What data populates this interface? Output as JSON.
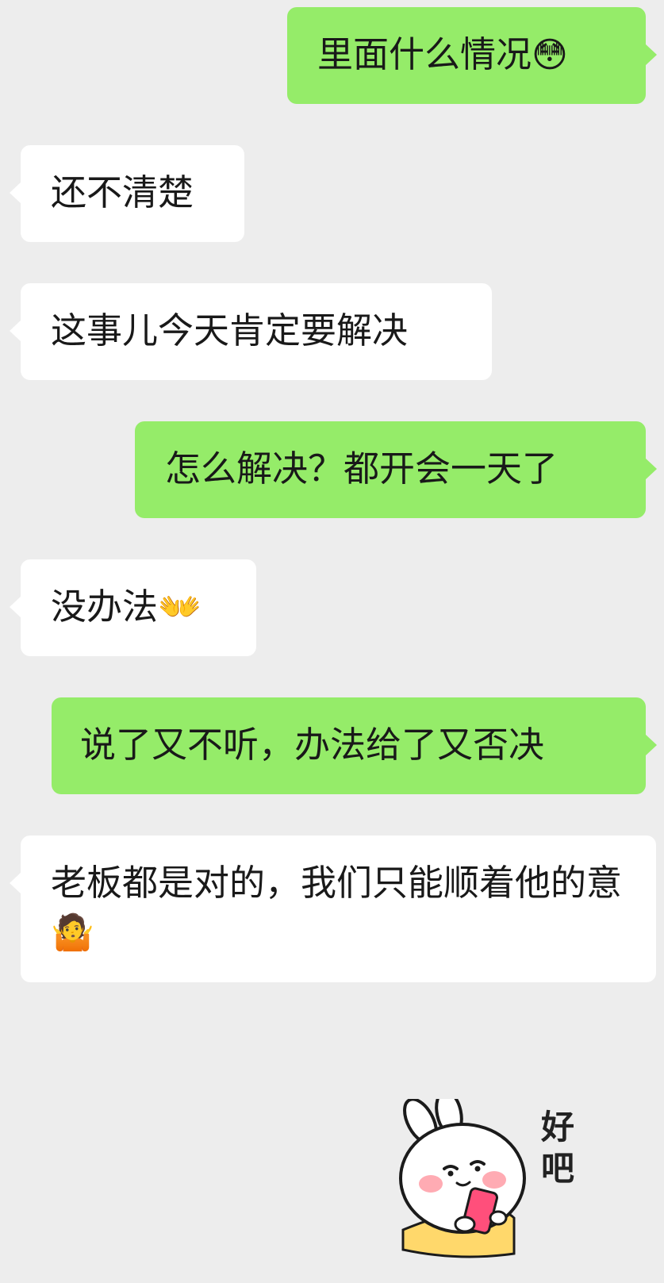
{
  "messages": [
    {
      "side": "out",
      "text": "里面什么情况",
      "emoji": "😳"
    },
    {
      "side": "in",
      "text": "还不清楚"
    },
    {
      "side": "in",
      "text": "这事儿今天肯定要解决"
    },
    {
      "side": "out",
      "text": "怎么解决？都开会一天了"
    },
    {
      "side": "in",
      "text": "没办法",
      "emoji": "👐"
    },
    {
      "side": "out",
      "text": "说了又不听，办法给了又否决"
    },
    {
      "side": "in",
      "text": "老板都是对的，我们只能顺着他的意",
      "emoji": "🤷"
    }
  ],
  "sticker": {
    "icon": "rabbit-holding-phone-sticker",
    "text": "好吧"
  },
  "colors": {
    "background": "#ededed",
    "incoming_bubble": "#ffffff",
    "outgoing_bubble": "#95ec69",
    "text": "#191919"
  }
}
